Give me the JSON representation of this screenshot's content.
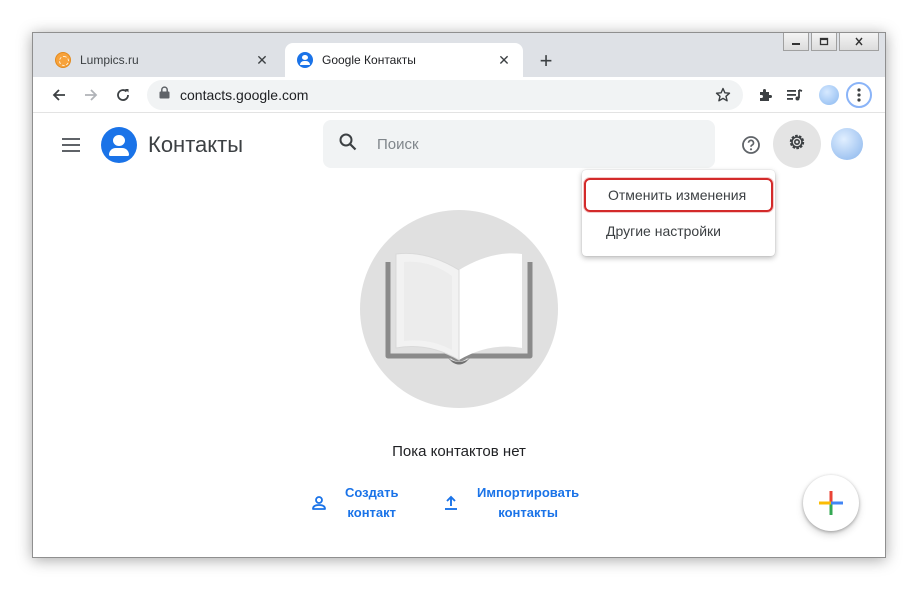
{
  "browser": {
    "tabs": [
      {
        "title": "Lumpics.ru",
        "active": false
      },
      {
        "title": "Google Контакты",
        "active": true
      }
    ],
    "address": "contacts.google.com"
  },
  "app": {
    "title": "Контакты",
    "search_placeholder": "Поиск"
  },
  "dropdown": {
    "items": [
      {
        "label": "Отменить изменения",
        "highlighted": true
      },
      {
        "label": "Другие настройки",
        "highlighted": false
      }
    ]
  },
  "empty_state": {
    "message": "Пока контактов нет",
    "create_line1": "Создать",
    "create_line2": "контакт",
    "import_line1": "Импортировать",
    "import_line2": "контакты"
  },
  "colors": {
    "accent": "#1a73e8",
    "highlight_outline": "#d32a2a",
    "search_bg": "#f1f3f4"
  },
  "icons": [
    "back-arrow-icon",
    "forward-arrow-icon",
    "reload-icon",
    "lock-icon",
    "star-icon",
    "extensions-icon",
    "media-control-icon",
    "kebab-menu-icon",
    "hamburger-icon",
    "search-icon",
    "help-icon",
    "gear-icon",
    "person-add-icon",
    "upload-icon",
    "plus-icon"
  ]
}
